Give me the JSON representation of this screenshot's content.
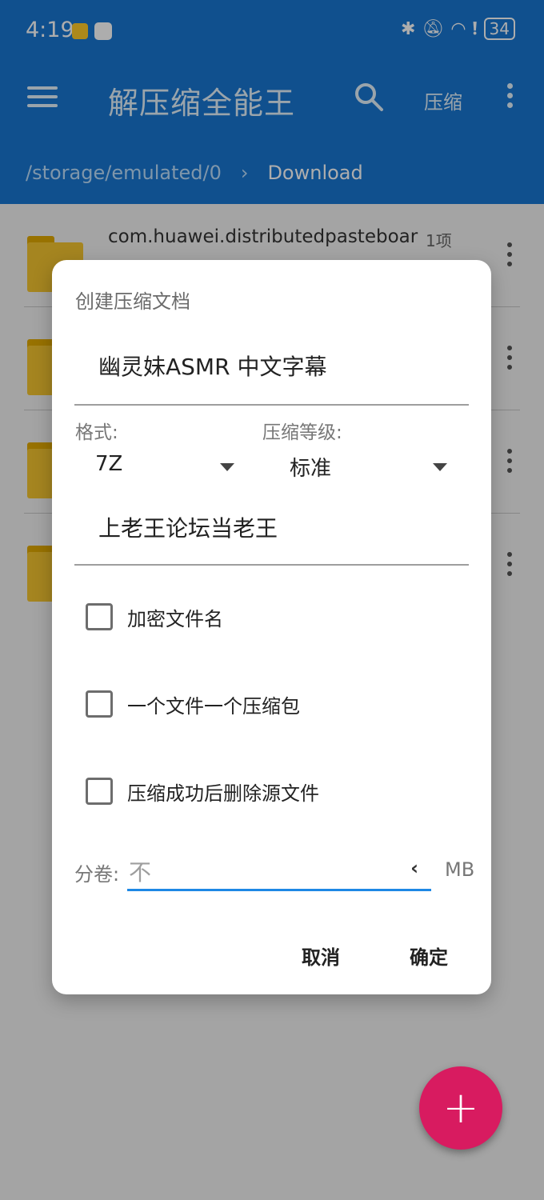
{
  "status_bar": {
    "time": "4:19",
    "battery": "34"
  },
  "app_bar": {
    "title": "解压缩全能王",
    "compress_action": "压缩",
    "breadcrumb": [
      "/storage/emulated/0",
      "Download"
    ]
  },
  "file_list": [
    {
      "name": "com.huawei.distributedpasteboar",
      "count": "1项"
    },
    {
      "name": "",
      "count": ""
    },
    {
      "name": "",
      "count": ""
    },
    {
      "name": "",
      "count": ""
    }
  ],
  "dialog": {
    "title": "创建压缩文档",
    "archive_name": "幽灵妹ASMR 中文字幕",
    "format_label": "格式:",
    "format_value": "7Z",
    "level_label": "压缩等级:",
    "level_value": "标准",
    "password_value": "上老王论坛当老王",
    "checkboxes": [
      {
        "label": "加密文件名",
        "checked": false
      },
      {
        "label": "一个文件一个压缩包",
        "checked": false
      },
      {
        "label": "压缩成功后删除源文件",
        "checked": false
      }
    ],
    "split_label": "分卷:",
    "split_placeholder": "不",
    "split_unit": "MB",
    "cancel_label": "取消",
    "ok_label": "确定"
  },
  "fab_icon": "plus-icon",
  "colors": {
    "primary": "#1976d2",
    "accent": "#d81b60",
    "input_focus": "#1e88e5"
  }
}
